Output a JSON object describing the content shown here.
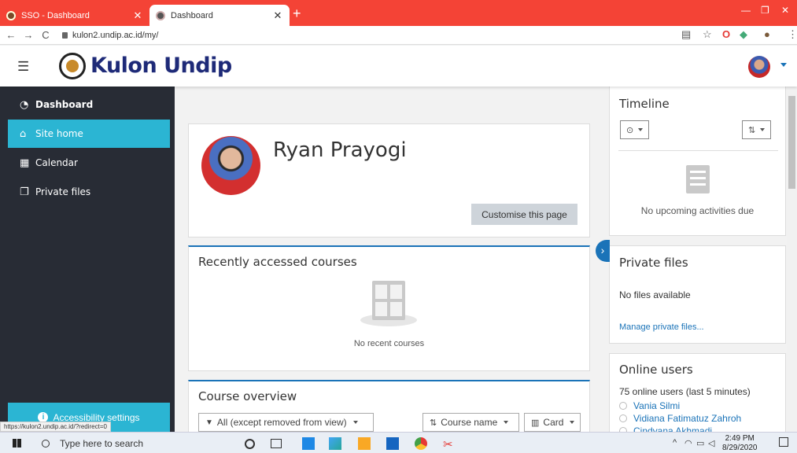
{
  "browser": {
    "tabs": [
      {
        "title": "SSO - Dashboard",
        "active": false
      },
      {
        "title": "Dashboard",
        "active": true
      }
    ],
    "new_tab": "+",
    "url": "kulon2.undip.ac.id/my/",
    "status_url": "https://kulon2.undip.ac.id/?redirect=0"
  },
  "header": {
    "brand": "Kulon Undip"
  },
  "sidebar": {
    "items": [
      {
        "label": "Dashboard",
        "icon": "gauge-icon",
        "active": false
      },
      {
        "label": "Site home",
        "icon": "home-icon",
        "active": true
      },
      {
        "label": "Calendar",
        "icon": "calendar-icon",
        "active": false
      },
      {
        "label": "Private files",
        "icon": "files-icon",
        "active": false
      }
    ],
    "accessibility": "Accessibility settings"
  },
  "profile": {
    "name": "Ryan Prayogi",
    "customise_button": "Customise this page"
  },
  "recent_courses": {
    "title": "Recently accessed courses",
    "empty": "No recent courses"
  },
  "course_overview": {
    "title": "Course overview",
    "filter": "All (except removed from view)",
    "sort": "Course name",
    "view": "Card"
  },
  "timeline": {
    "title": "Timeline",
    "empty": "No upcoming activities due"
  },
  "private_files": {
    "title": "Private files",
    "empty": "No files available",
    "manage_link": "Manage private files..."
  },
  "online_users": {
    "title": "Online users",
    "summary": "75 online users (last 5 minutes)",
    "users": [
      "Vania Silmi",
      "Vidiana Fatimatuz Zahroh",
      "Cindyana Akhmadi"
    ]
  },
  "taskbar": {
    "search_placeholder": "Type here to search",
    "time": "2:49 PM",
    "date": "8/29/2020"
  },
  "colors": {
    "tabbar": "#f44336",
    "sidebar": "#282c35",
    "accent": "#2bb5d3",
    "link": "#1a73b8",
    "brand": "#1e2a78"
  }
}
